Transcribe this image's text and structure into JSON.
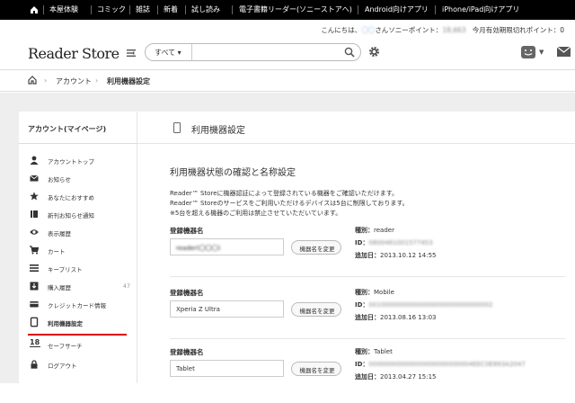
{
  "top_nav": {
    "home_icon": "home-icon",
    "items": [
      "本屋体験",
      "コミック",
      "雑誌",
      "新着",
      "試し読み",
      "電子書籍リーダー(ソニーストアへ)",
      "Android向けアプリ",
      "iPhone/iPad向けアプリ"
    ]
  },
  "user_bar": {
    "greeting_prefix": "こんにちは、",
    "user_name": "〇〇",
    "greeting_suffix": "さん",
    "points_label": "ソニーポイント：",
    "points_value": "18,663",
    "expire_label": "今月有効期限切れポイント：",
    "expire_value": "0"
  },
  "header": {
    "logo": "Reader Store",
    "search_scope": "すべて",
    "search_placeholder": "",
    "search_icon": "search-icon",
    "settings_icon": "gear-icon",
    "user_icon": "face-icon",
    "mail_icon": "mail-icon"
  },
  "breadcrumb": {
    "home_icon": "home-icon",
    "items": [
      "アカウント",
      "利用機器設定"
    ]
  },
  "sidebar": {
    "title": "アカウント(マイページ)",
    "items": [
      {
        "icon": "user-icon",
        "label": "アカウントトップ",
        "count": ""
      },
      {
        "icon": "mail-icon",
        "label": "お知らせ",
        "count": ""
      },
      {
        "icon": "star-icon",
        "label": "あなたにおすすめ",
        "count": ""
      },
      {
        "icon": "book-icon",
        "label": "新刊お知らせ通知",
        "count": ""
      },
      {
        "icon": "eye-icon",
        "label": "表示履歴",
        "count": ""
      },
      {
        "icon": "cart-icon",
        "label": "カート",
        "count": ""
      },
      {
        "icon": "list-icon",
        "label": "キープリスト",
        "count": ""
      },
      {
        "icon": "download-icon",
        "label": "購入履歴",
        "count": "47"
      },
      {
        "icon": "card-icon",
        "label": "クレジットカード情報",
        "count": ""
      },
      {
        "icon": "device-icon",
        "label": "利用機器設定",
        "count": ""
      },
      {
        "icon": "age-18-icon",
        "label": "セーフサーチ",
        "count": ""
      },
      {
        "icon": "lock-icon",
        "label": "ログアウト",
        "count": ""
      }
    ]
  },
  "main": {
    "page_title": "利用機器設定",
    "section_title": "利用機器状態の確認と名称設定",
    "description": [
      "Reader™ Storeに機器認証によって登録されている機器をご確認いただけます。",
      "Reader™ Storeのサービスをご利用いただけるデバイスは5台に制限しております。",
      "※5台を超える機器のご利用は禁止させていただいています。"
    ],
    "name_label": "登録機器名",
    "rename_button": "機器名を変更",
    "type_label": "種別：",
    "id_label": "ID：",
    "added_label": "追加日：",
    "devices": [
      {
        "name": "reader(〇〇〇)",
        "type": "reader",
        "id": "0800461001577453",
        "added": "2013.10.12 14:55"
      },
      {
        "name": "Xperia Z Ultra",
        "type": "Mobile",
        "id": "0010000000000000000000000000002",
        "added": "2013.08.16 13:03"
      },
      {
        "name": "Tablet",
        "type": "Tablet",
        "id": "00000000000000000000000004EEC0E893A2047",
        "added": "2013.04.27 15:15"
      }
    ]
  }
}
